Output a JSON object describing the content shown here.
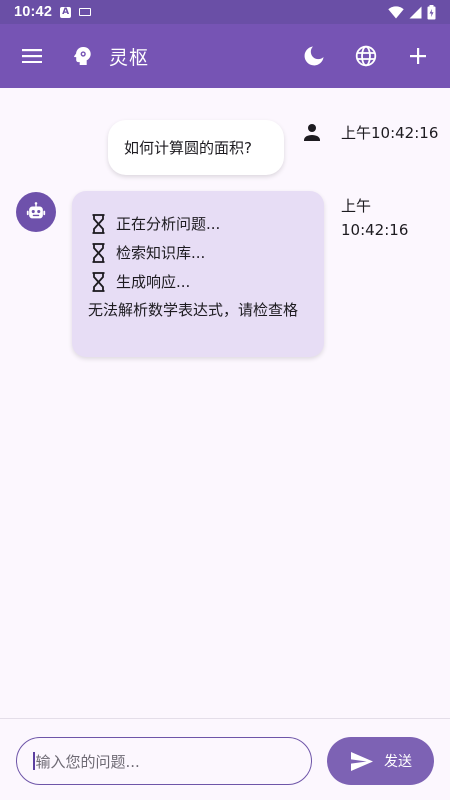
{
  "status_bar": {
    "time": "10:42",
    "app_icon_letter": "A"
  },
  "app_bar": {
    "title": "灵枢",
    "icons": [
      "menu-icon",
      "brain-logo-icon",
      "moon-icon",
      "globe-icon",
      "add-icon"
    ]
  },
  "messages": {
    "user": {
      "text": "如何计算圆的面积?",
      "time": "上午10:42:16"
    },
    "bot": {
      "steps": [
        "正在分析问题...",
        "检索知识库...",
        "生成响应..."
      ],
      "final": "无法解析数学表达式，请检查格",
      "time": "上午\n10:42:16"
    }
  },
  "input": {
    "placeholder": "输入您的问题...",
    "send_label": "发送"
  },
  "colors": {
    "status_bar": "#6a4fa6",
    "app_bar": "#7654b4",
    "background": "#fcf7fe",
    "bot_bubble": "#e7ddf5",
    "send_button": "#7d62b4"
  }
}
